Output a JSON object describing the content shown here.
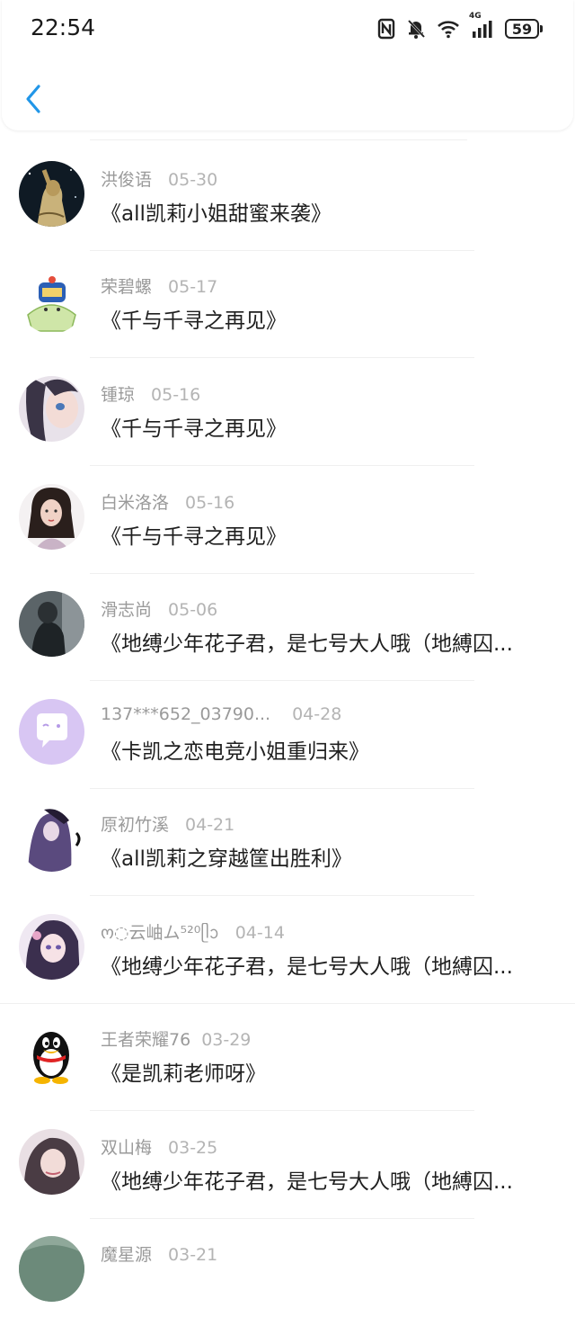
{
  "status_bar": {
    "time": "22:54",
    "battery": "59",
    "network": "4G",
    "icons": [
      "nfc-icon",
      "bell-muted-icon",
      "wifi-icon",
      "signal-icon",
      "battery-icon"
    ]
  },
  "header": {
    "back_icon": "chevron-left-icon"
  },
  "items": [
    {
      "name": "洪俊语",
      "date": "05-30",
      "title": "《all凯莉小姐甜蜜来袭》"
    },
    {
      "name": "荣碧螺",
      "date": "05-17",
      "title": "《千与千寻之再见》"
    },
    {
      "name": "锺琼",
      "date": "05-16",
      "title": "《千与千寻之再见》"
    },
    {
      "name": "白米洛洛",
      "date": "05-16",
      "title": "《千与千寻之再见》"
    },
    {
      "name": "滑志尚",
      "date": "05-06",
      "title": "《地缚少年花子君，是七号大人哦（地縛囚..."
    },
    {
      "name": "137***652_03790...",
      "date": "04-28",
      "title": "《卡凯之恋电竞小姐重归来》"
    },
    {
      "name": "原初竹溪",
      "date": "04-21",
      "title": "《all凯莉之穿越筐出胜利》"
    },
    {
      "name": "ო◌云岫ム⁵²⁰ᥫᩣ",
      "date": "04-14",
      "title": "《地缚少年花子君，是七号大人哦（地縛囚..."
    },
    {
      "name": "王者荣耀76",
      "date": "03-29",
      "title": "《是凯莉老师呀》"
    },
    {
      "name": "双山梅",
      "date": "03-25",
      "title": "《地缚少年花子君，是七号大人哦（地縛囚..."
    },
    {
      "name": "魔星源",
      "date": "03-21",
      "title": ""
    }
  ]
}
